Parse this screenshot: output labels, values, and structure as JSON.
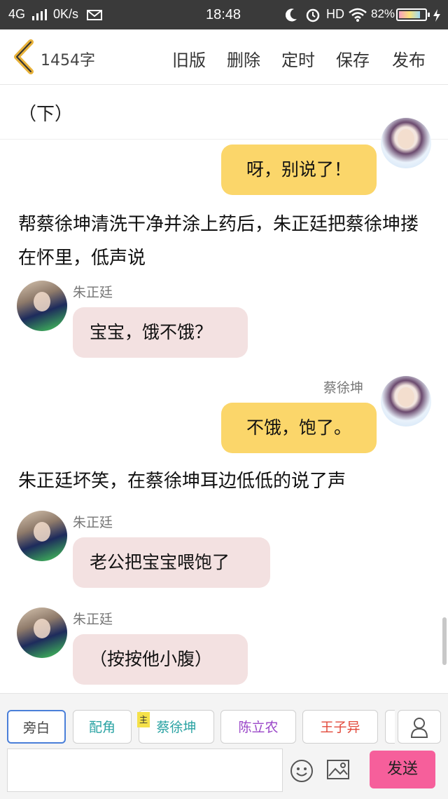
{
  "status_bar": {
    "network": "4G",
    "speed": "0K/s",
    "time": "18:48",
    "hd": "HD",
    "battery": "82%",
    "battery_level": 0.82
  },
  "header": {
    "word_count": "1454字",
    "old_version": "旧版",
    "delete": "删除",
    "schedule": "定时",
    "save": "保存",
    "publish": "发布"
  },
  "chapter_title": "（下）",
  "messages": [
    {
      "type": "bubble",
      "side": "right",
      "color": "yellow",
      "text": "呀，别说了！"
    },
    {
      "type": "narration",
      "text": "帮蔡徐坤清洗干净并涂上药后，朱正廷把蔡徐坤搂在怀里，低声说"
    },
    {
      "type": "bubble",
      "side": "left",
      "name": "朱正廷",
      "color": "pink",
      "text": "宝宝，饿不饿？"
    },
    {
      "type": "bubble",
      "side": "right",
      "name": "蔡徐坤",
      "color": "yellow",
      "text": "不饿，饱了。"
    },
    {
      "type": "narration",
      "text": "朱正廷坏笑，在蔡徐坤耳边低低的说了声"
    },
    {
      "type": "bubble",
      "side": "left",
      "name": "朱正廷",
      "color": "pink",
      "text": "老公把宝宝喂饱了"
    },
    {
      "type": "bubble",
      "side": "left",
      "name": "朱正廷",
      "color": "pink",
      "text": "（按按他小腹）"
    }
  ],
  "tabs": [
    {
      "label": "旁白",
      "color": "#444444"
    },
    {
      "label": "配角",
      "color": "#2aa3a3"
    },
    {
      "label": "蔡徐坤",
      "color": "#2aa3a3",
      "badge": "主"
    },
    {
      "label": "陈立农",
      "color": "#9a46c8"
    },
    {
      "label": "王子异",
      "color": "#e24a3b"
    }
  ],
  "composer": {
    "placeholder": "",
    "send_label": "发送"
  },
  "colors": {
    "pink_bubble": "#f3e1e1",
    "yellow_bubble": "#fbd66a",
    "send_button": "#f65f9b",
    "status_bar": "#3a3a3a"
  }
}
